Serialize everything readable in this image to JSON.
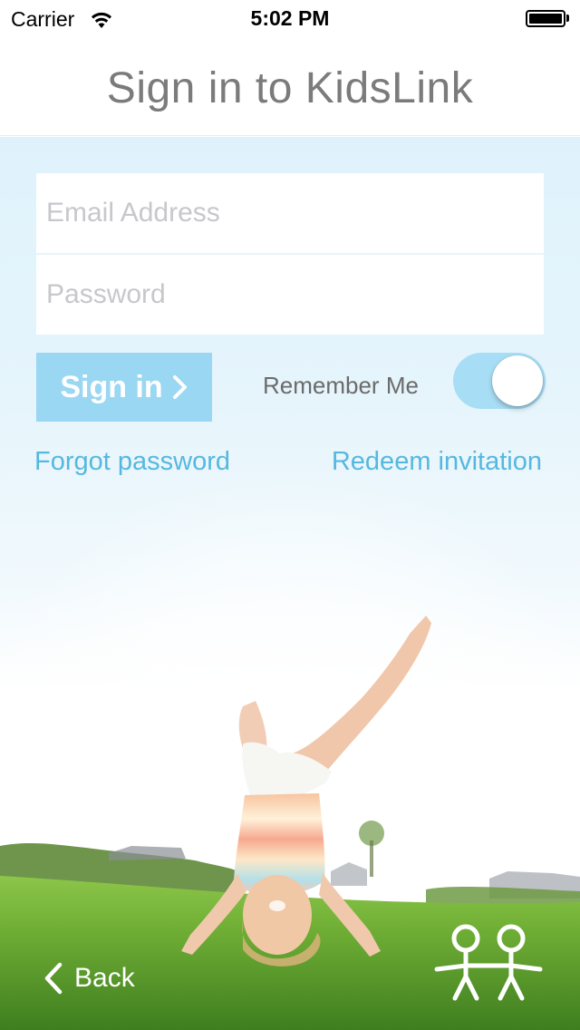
{
  "status_bar": {
    "carrier": "Carrier",
    "time": "5:02 PM"
  },
  "header": {
    "title": "Sign in to KidsLink"
  },
  "form": {
    "email_placeholder": "Email Address",
    "password_placeholder": "Password",
    "signin_label": "Sign in",
    "remember_label": "Remember Me",
    "remember_on": true
  },
  "links": {
    "forgot": "Forgot password",
    "redeem": "Redeem invitation"
  },
  "footer": {
    "back_label": "Back"
  },
  "colors": {
    "accent": "#56b8df",
    "button": "#9ad7f2",
    "toggle": "#a8def5",
    "background": "#dff2fb",
    "title": "#7b7b7b"
  },
  "icons": [
    "wifi-icon",
    "battery-icon",
    "chevron-right-icon",
    "chevron-left-icon",
    "kidslink-logo-icon"
  ]
}
